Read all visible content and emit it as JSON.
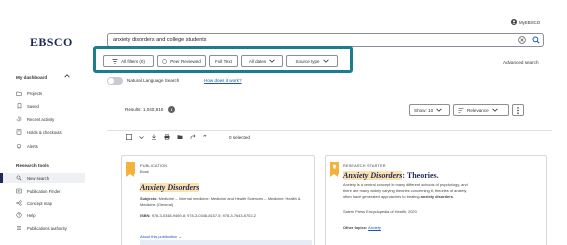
{
  "header": {
    "logo": "EBSCO",
    "account_label": "MyEBSCO"
  },
  "search": {
    "query": "anxiety disorders and college students",
    "advanced_label": "Advanced search"
  },
  "filters": {
    "all_filters": "All filters (0)",
    "peer_reviewed": "Peer Reviewed",
    "full_text": "Full Text",
    "all_dates": "All dates",
    "source_type": "Source type"
  },
  "nl_search": {
    "label": "Natural Language Search",
    "link": "How does it work?"
  },
  "results": {
    "count": "Results: 1,040,910",
    "show": "Show: 10",
    "sort": "Relevance",
    "selected": "0 selected"
  },
  "sidebar": {
    "dashboard_heading": "My dashboard",
    "dashboard_items": [
      {
        "label": "Projects",
        "icon": "folder-icon"
      },
      {
        "label": "Saved",
        "icon": "bookmark-icon"
      },
      {
        "label": "Recent activity",
        "icon": "history-icon"
      },
      {
        "label": "Holds & checkouts",
        "icon": "book-icon"
      },
      {
        "label": "Alerts",
        "icon": "bell-icon"
      }
    ],
    "tools_heading": "Research tools",
    "tools_items": [
      {
        "label": "New search",
        "icon": "search-icon"
      },
      {
        "label": "Publication Finder",
        "icon": "publication-icon"
      },
      {
        "label": "Concept map",
        "icon": "concept-map-icon"
      },
      {
        "label": "Help",
        "icon": "help-icon"
      },
      {
        "label": "Publications authority",
        "icon": "list-icon"
      }
    ]
  },
  "card1": {
    "kicker": "PUBLICATION",
    "type": "Book",
    "title": "Anxiety Disorders",
    "subjects_label": "Subjects:",
    "subjects": "Medicine -- Internal medicine: Medicine and Health Sciences -- Medicine: Health & Medicine (General)",
    "isbn_label": "ISBN:",
    "isbn": "978-3-0348-9469-8; 978-3-0348-8157-5; 978-3-7643-6702-2",
    "about_link": "About this publication →"
  },
  "card2": {
    "kicker": "RESEARCH STARTER",
    "title_hl": "Anxiety Disorders",
    "title_rest": ": Theories.",
    "desc_1": "Anxiety is a central concept in many different schools of psychology, and",
    "desc_2": "there are many widely varying theories concerning it; theories of anxiety",
    "desc_3a": "often have generated approaches to treating ",
    "desc_3b": "anxiety disorders",
    "desc_3c": ".",
    "source": "Salem Press Encyclopedia of Health, 2020",
    "other_label": "Other topics:",
    "other_link": "Anxiety"
  },
  "colors": {
    "brand_navy": "#1d2a57",
    "highlight_teal": "#1b7d8e",
    "tag_gold": "#f2b33d",
    "link_blue": "#1a56b0"
  }
}
